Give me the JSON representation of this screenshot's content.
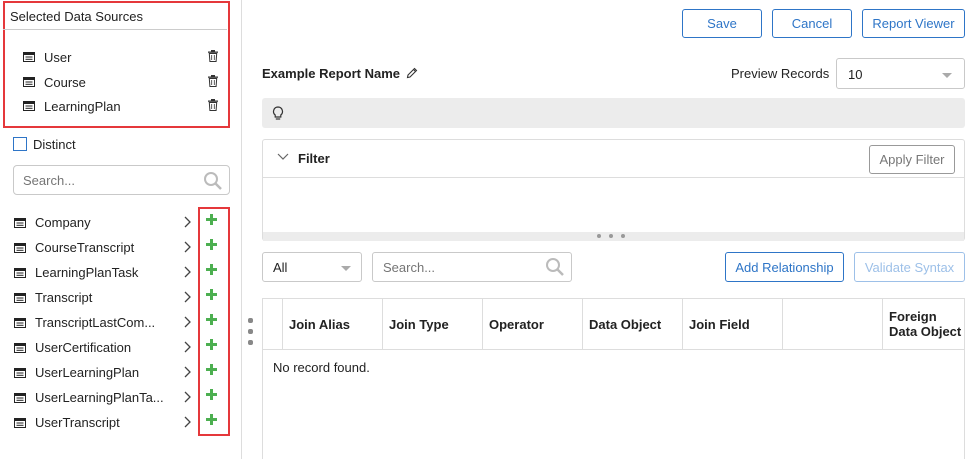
{
  "selected_sources": {
    "title": "Selected Data Sources",
    "items": [
      "User",
      "Course",
      "LearningPlan"
    ]
  },
  "distinct_label": "Distinct",
  "left_search": {
    "placeholder": "Search..."
  },
  "objects": [
    "Company",
    "CourseTranscript",
    "LearningPlanTask",
    "Transcript",
    "TranscriptLastCom...",
    "UserCertification",
    "UserLearningPlan",
    "UserLearningPlanTa...",
    "UserTranscript"
  ],
  "toolbar": {
    "save": "Save",
    "cancel": "Cancel",
    "report_viewer": "Report Viewer"
  },
  "report_name": "Example Report Name",
  "preview": {
    "label": "Preview Records",
    "value": "10"
  },
  "filter": {
    "label": "Filter",
    "apply": "Apply Filter"
  },
  "relations": {
    "scope": "All",
    "search_placeholder": "Search...",
    "add_relationship": "Add Relationship",
    "validate_syntax": "Validate Syntax"
  },
  "table": {
    "columns": [
      "Join Alias",
      "Join Type",
      "Operator",
      "Data Object",
      "Join Field",
      "",
      "Foreign Data Object"
    ],
    "empty_text": "No record found."
  },
  "colors": {
    "accent": "#2e75c7",
    "highlight": "#e5383b",
    "add": "#4caf50"
  }
}
